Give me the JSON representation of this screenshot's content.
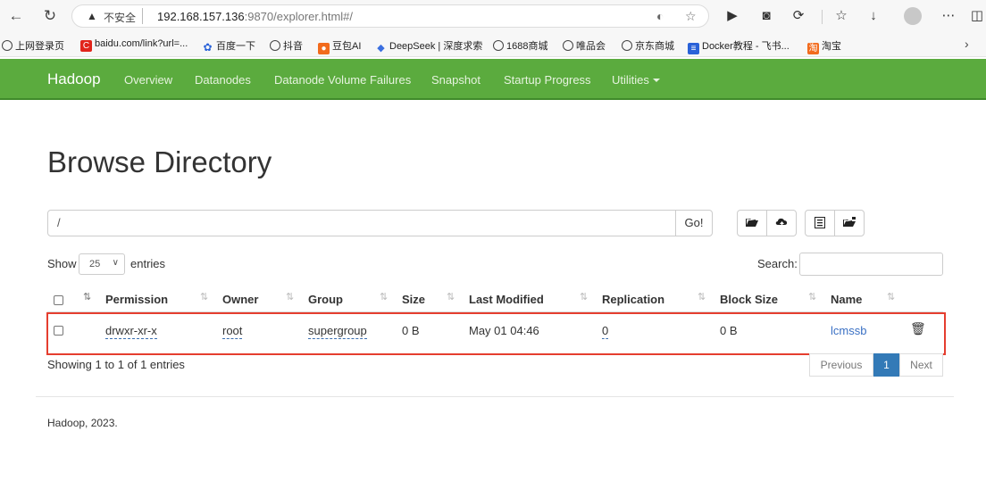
{
  "browser": {
    "security_label": "不安全",
    "url_host": "192.168.157.136",
    "url_rest": ":9870/explorer.html#/",
    "bookmarks": [
      {
        "label": "上网登录页",
        "icon": "globe-icon"
      },
      {
        "label": "baidu.com/link?url=...",
        "icon": "baidu-icon"
      },
      {
        "label": "百度一下",
        "icon": "baidu-paw-icon"
      },
      {
        "label": "抖音",
        "icon": "globe-icon"
      },
      {
        "label": "豆包AI",
        "icon": "doubao-icon"
      },
      {
        "label": "DeepSeek | 深度求索",
        "icon": "deepseek-icon"
      },
      {
        "label": "1688商城",
        "icon": "globe-icon"
      },
      {
        "label": "唯品会",
        "icon": "globe-icon"
      },
      {
        "label": "京东商城",
        "icon": "globe-icon"
      },
      {
        "label": "Docker教程 - 飞书...",
        "icon": "feishu-doc-icon"
      },
      {
        "label": "淘宝",
        "icon": "taobao-icon"
      }
    ]
  },
  "navbar": {
    "brand": "Hadoop",
    "links": [
      "Overview",
      "Datanodes",
      "Datanode Volume Failures",
      "Snapshot",
      "Startup Progress",
      "Utilities"
    ],
    "bg_color": "#5bab3e"
  },
  "page": {
    "title": "Browse Directory",
    "path_value": "/",
    "go_label": "Go!",
    "show_label": "Show",
    "entries_value": "25",
    "entries_label": "entries",
    "search_label": "Search:",
    "columns": [
      "Permission",
      "Owner",
      "Group",
      "Size",
      "Last Modified",
      "Replication",
      "Block Size",
      "Name"
    ],
    "rows": [
      {
        "permission": "drwxr-xr-x",
        "owner": "root",
        "group": "supergroup",
        "size": "0 B",
        "last_modified": "May 01 04:46",
        "replication": "0",
        "block_size": "0 B",
        "name": "lcmssb"
      }
    ],
    "info": "Showing 1 to 1 of 1 entries",
    "pagination": {
      "previous": "Previous",
      "current": "1",
      "next": "Next"
    },
    "footer": "Hadoop, 2023.",
    "highlight_color": "#e53e2f"
  }
}
